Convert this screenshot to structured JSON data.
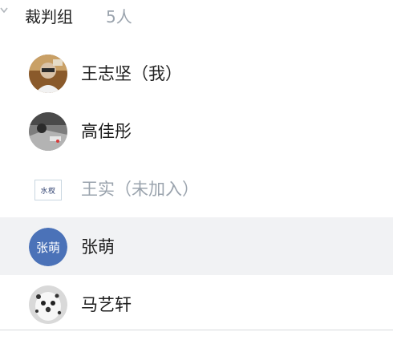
{
  "group": {
    "name": "裁判组",
    "count": "5人"
  },
  "members": [
    {
      "name": "王志坚（我）",
      "avatar": "photo-man-glasses"
    },
    {
      "name": "高佳彤",
      "avatar": "photo-street"
    },
    {
      "name": "王实（未加入）",
      "avatar": "logo-shuiyin",
      "logo_text": "水杈"
    },
    {
      "name": "张萌",
      "avatar": "text-avatar",
      "avatar_text": "张萌"
    },
    {
      "name": "马艺轩",
      "avatar": "photo-dalmatian"
    }
  ],
  "colors": {
    "accent": "#4b72b8",
    "selected_bg": "#f1f2f4",
    "muted": "#9aa3ad"
  }
}
